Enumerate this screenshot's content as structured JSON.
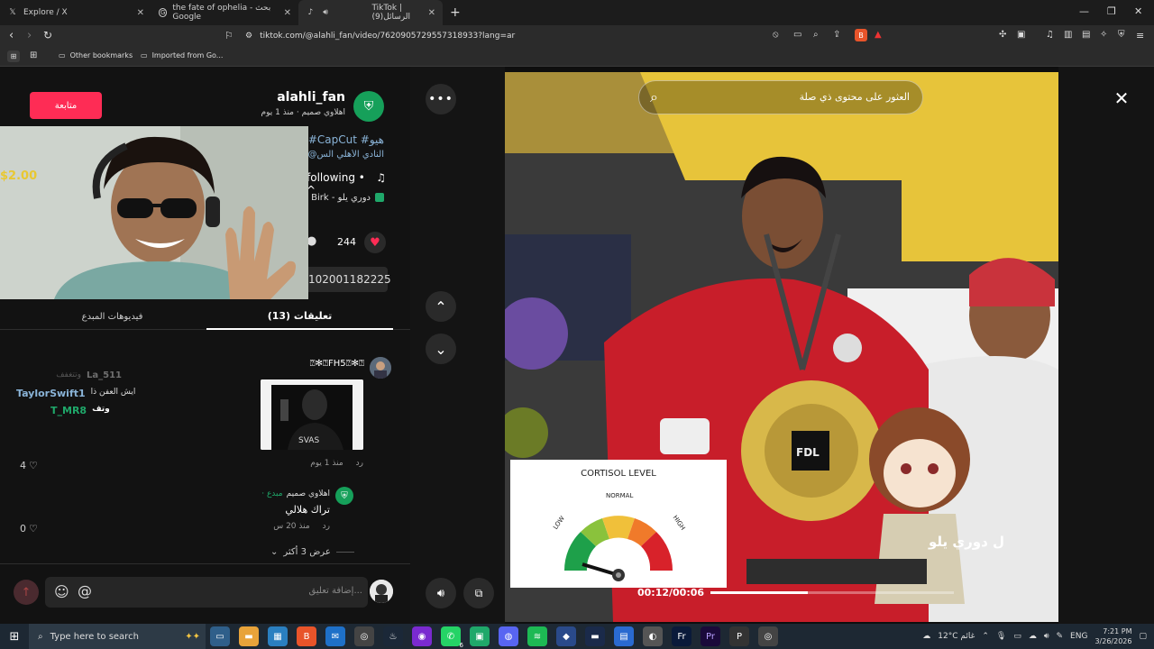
{
  "browser": {
    "tabs": [
      {
        "title": "Explore / X",
        "icon": "x-logo-icon",
        "active": false
      },
      {
        "title": "the fate of ophelia - بحث Google",
        "icon": "google-icon",
        "active": false
      },
      {
        "title": "TikTok | (9)الرسائل",
        "icon": "tiktok-icon",
        "active": true
      }
    ],
    "url": "tiktok.com/@alahli_fan/video/7620905729557318933?lang=ar",
    "bookmarks": [
      "Other bookmarks",
      "Imported from Go..."
    ]
  },
  "post": {
    "username": "alahli_fan",
    "subtitle": "اهلاوي صميم · منذ 1 يوم",
    "follow_label": "متابعة",
    "caption_tags": "#CapCut #هيو",
    "caption_line2": "@النادي الأهلي الس",
    "music_line": "following • ^",
    "music_line2": "Birk - دوري يلو",
    "likes": "244",
    "link_text": "102001182225",
    "price_overlay": "$2.00"
  },
  "comments_tabs": {
    "comments": "(13) تعليقات",
    "creator_videos": "فيديوهات المبدع"
  },
  "comments": [
    {
      "author": "⍰✻⍰FH5⍰✻⍰",
      "mention1": "La_511",
      "mention1_suffix": "وتتغفف",
      "text": "ايش العفن ذا",
      "mention2": "TaylorSwift1",
      "mention3": "T_MR8",
      "mention3_suffix": "وتف",
      "time": "منذ 1 يوم",
      "reply": "رد",
      "likes": "4"
    },
    {
      "author": "اهلاوي صميم",
      "creator_badge": "· مبدع",
      "text": "تراك هلالي",
      "time": "منذ 20 س",
      "reply": "رد",
      "likes": "0"
    }
  ],
  "more_replies": "عرض 3 أكثر",
  "comment_input_placeholder": "إضافة تعليق...",
  "video": {
    "search_placeholder": "العثور على محتوى ذي صلة",
    "timecode": "00:12/00:06",
    "cortisol_title": "CORTISOL LEVEL",
    "gauge_labels": {
      "low": "LOW",
      "normal": "NORMAL",
      "high": "HIGH"
    },
    "banner_text": "ل دوري يلو",
    "progress": 0.4
  },
  "taskbar": {
    "search_placeholder": "Type here to search",
    "weather": "12°C غائم",
    "lang": "ENG",
    "time": "7:21 PM",
    "date": "3/26/2026",
    "whatsapp_badge": "6"
  },
  "colors": {
    "tiktok_red": "#fe2c55",
    "mention_blue": "#8ab4d8",
    "creator_green": "#1fa86a",
    "taskbar_bg": "#1d2833"
  }
}
